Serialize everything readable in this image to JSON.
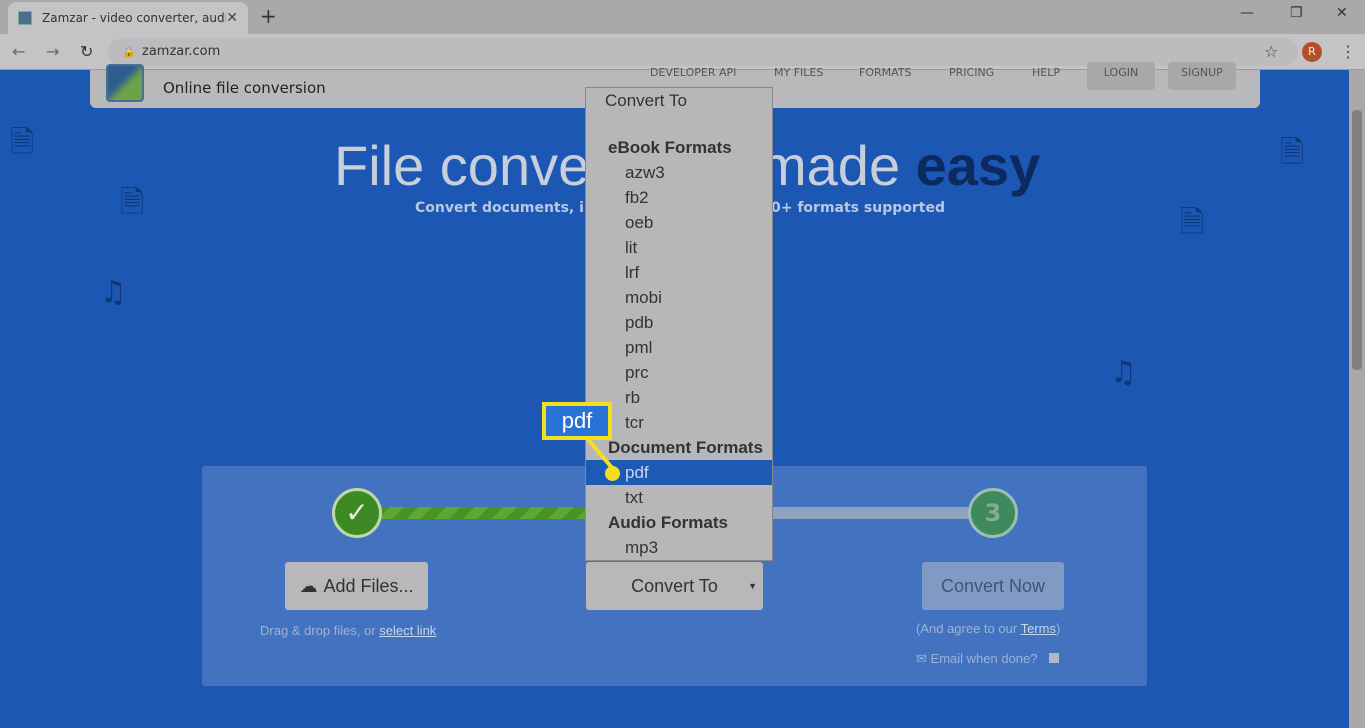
{
  "browser": {
    "tab_title": "Zamzar - video converter, audio",
    "url": "zamzar.com",
    "avatar_letter": "R"
  },
  "header": {
    "tagline": "Online file conversion",
    "nav": [
      "DEVELOPER API",
      "MY FILES",
      "FORMATS",
      "PRICING",
      "HELP"
    ],
    "login": "LOGIN",
    "signup": "SIGNUP"
  },
  "hero": {
    "title_a": "File conve",
    "title_b": "made ",
    "title_c": "easy",
    "subtitle_a": "Convert documents, im",
    "subtitle_b": "0+ formats supported"
  },
  "steps": {
    "step3": "3"
  },
  "buttons": {
    "add_files": "Add Files...",
    "convert_to": "Convert To",
    "convert_now": "Convert Now"
  },
  "hints": {
    "drag": "Drag & drop files, or ",
    "select_link": "select link",
    "agree": "(And agree to our ",
    "terms": "Terms",
    "agree_end": ")",
    "email": "Email when done?"
  },
  "dropdown": {
    "placeholder": "Convert To",
    "groups": [
      {
        "label": "eBook Formats",
        "options": [
          "azw3",
          "fb2",
          "oeb",
          "lit",
          "lrf",
          "mobi",
          "pdb",
          "pml",
          "prc",
          "rb",
          "tcr"
        ]
      },
      {
        "label": "Document Formats",
        "options": [
          "pdf",
          "txt"
        ]
      },
      {
        "label": "Audio Formats",
        "options": [
          "mp3"
        ]
      }
    ],
    "selected": "pdf"
  },
  "callout": {
    "text": "pdf",
    "color": "#f3e01b"
  }
}
